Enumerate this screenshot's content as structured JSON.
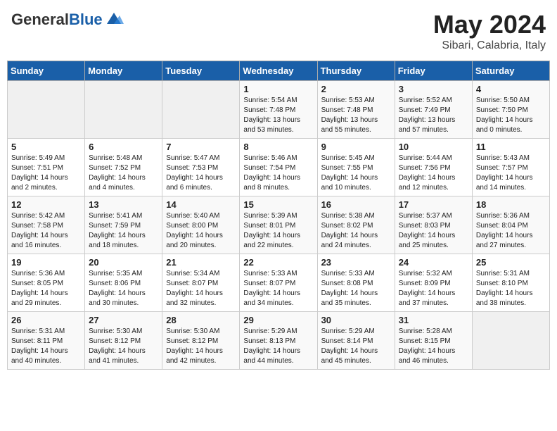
{
  "header": {
    "logo_general": "General",
    "logo_blue": "Blue",
    "month": "May 2024",
    "location": "Sibari, Calabria, Italy"
  },
  "weekdays": [
    "Sunday",
    "Monday",
    "Tuesday",
    "Wednesday",
    "Thursday",
    "Friday",
    "Saturday"
  ],
  "rows": [
    [
      {
        "day": "",
        "sunrise": "",
        "sunset": "",
        "daylight": ""
      },
      {
        "day": "",
        "sunrise": "",
        "sunset": "",
        "daylight": ""
      },
      {
        "day": "",
        "sunrise": "",
        "sunset": "",
        "daylight": ""
      },
      {
        "day": "1",
        "sunrise": "Sunrise: 5:54 AM",
        "sunset": "Sunset: 7:48 PM",
        "daylight": "Daylight: 13 hours and 53 minutes."
      },
      {
        "day": "2",
        "sunrise": "Sunrise: 5:53 AM",
        "sunset": "Sunset: 7:48 PM",
        "daylight": "Daylight: 13 hours and 55 minutes."
      },
      {
        "day": "3",
        "sunrise": "Sunrise: 5:52 AM",
        "sunset": "Sunset: 7:49 PM",
        "daylight": "Daylight: 13 hours and 57 minutes."
      },
      {
        "day": "4",
        "sunrise": "Sunrise: 5:50 AM",
        "sunset": "Sunset: 7:50 PM",
        "daylight": "Daylight: 14 hours and 0 minutes."
      }
    ],
    [
      {
        "day": "5",
        "sunrise": "Sunrise: 5:49 AM",
        "sunset": "Sunset: 7:51 PM",
        "daylight": "Daylight: 14 hours and 2 minutes."
      },
      {
        "day": "6",
        "sunrise": "Sunrise: 5:48 AM",
        "sunset": "Sunset: 7:52 PM",
        "daylight": "Daylight: 14 hours and 4 minutes."
      },
      {
        "day": "7",
        "sunrise": "Sunrise: 5:47 AM",
        "sunset": "Sunset: 7:53 PM",
        "daylight": "Daylight: 14 hours and 6 minutes."
      },
      {
        "day": "8",
        "sunrise": "Sunrise: 5:46 AM",
        "sunset": "Sunset: 7:54 PM",
        "daylight": "Daylight: 14 hours and 8 minutes."
      },
      {
        "day": "9",
        "sunrise": "Sunrise: 5:45 AM",
        "sunset": "Sunset: 7:55 PM",
        "daylight": "Daylight: 14 hours and 10 minutes."
      },
      {
        "day": "10",
        "sunrise": "Sunrise: 5:44 AM",
        "sunset": "Sunset: 7:56 PM",
        "daylight": "Daylight: 14 hours and 12 minutes."
      },
      {
        "day": "11",
        "sunrise": "Sunrise: 5:43 AM",
        "sunset": "Sunset: 7:57 PM",
        "daylight": "Daylight: 14 hours and 14 minutes."
      }
    ],
    [
      {
        "day": "12",
        "sunrise": "Sunrise: 5:42 AM",
        "sunset": "Sunset: 7:58 PM",
        "daylight": "Daylight: 14 hours and 16 minutes."
      },
      {
        "day": "13",
        "sunrise": "Sunrise: 5:41 AM",
        "sunset": "Sunset: 7:59 PM",
        "daylight": "Daylight: 14 hours and 18 minutes."
      },
      {
        "day": "14",
        "sunrise": "Sunrise: 5:40 AM",
        "sunset": "Sunset: 8:00 PM",
        "daylight": "Daylight: 14 hours and 20 minutes."
      },
      {
        "day": "15",
        "sunrise": "Sunrise: 5:39 AM",
        "sunset": "Sunset: 8:01 PM",
        "daylight": "Daylight: 14 hours and 22 minutes."
      },
      {
        "day": "16",
        "sunrise": "Sunrise: 5:38 AM",
        "sunset": "Sunset: 8:02 PM",
        "daylight": "Daylight: 14 hours and 24 minutes."
      },
      {
        "day": "17",
        "sunrise": "Sunrise: 5:37 AM",
        "sunset": "Sunset: 8:03 PM",
        "daylight": "Daylight: 14 hours and 25 minutes."
      },
      {
        "day": "18",
        "sunrise": "Sunrise: 5:36 AM",
        "sunset": "Sunset: 8:04 PM",
        "daylight": "Daylight: 14 hours and 27 minutes."
      }
    ],
    [
      {
        "day": "19",
        "sunrise": "Sunrise: 5:36 AM",
        "sunset": "Sunset: 8:05 PM",
        "daylight": "Daylight: 14 hours and 29 minutes."
      },
      {
        "day": "20",
        "sunrise": "Sunrise: 5:35 AM",
        "sunset": "Sunset: 8:06 PM",
        "daylight": "Daylight: 14 hours and 30 minutes."
      },
      {
        "day": "21",
        "sunrise": "Sunrise: 5:34 AM",
        "sunset": "Sunset: 8:07 PM",
        "daylight": "Daylight: 14 hours and 32 minutes."
      },
      {
        "day": "22",
        "sunrise": "Sunrise: 5:33 AM",
        "sunset": "Sunset: 8:07 PM",
        "daylight": "Daylight: 14 hours and 34 minutes."
      },
      {
        "day": "23",
        "sunrise": "Sunrise: 5:33 AM",
        "sunset": "Sunset: 8:08 PM",
        "daylight": "Daylight: 14 hours and 35 minutes."
      },
      {
        "day": "24",
        "sunrise": "Sunrise: 5:32 AM",
        "sunset": "Sunset: 8:09 PM",
        "daylight": "Daylight: 14 hours and 37 minutes."
      },
      {
        "day": "25",
        "sunrise": "Sunrise: 5:31 AM",
        "sunset": "Sunset: 8:10 PM",
        "daylight": "Daylight: 14 hours and 38 minutes."
      }
    ],
    [
      {
        "day": "26",
        "sunrise": "Sunrise: 5:31 AM",
        "sunset": "Sunset: 8:11 PM",
        "daylight": "Daylight: 14 hours and 40 minutes."
      },
      {
        "day": "27",
        "sunrise": "Sunrise: 5:30 AM",
        "sunset": "Sunset: 8:12 PM",
        "daylight": "Daylight: 14 hours and 41 minutes."
      },
      {
        "day": "28",
        "sunrise": "Sunrise: 5:30 AM",
        "sunset": "Sunset: 8:12 PM",
        "daylight": "Daylight: 14 hours and 42 minutes."
      },
      {
        "day": "29",
        "sunrise": "Sunrise: 5:29 AM",
        "sunset": "Sunset: 8:13 PM",
        "daylight": "Daylight: 14 hours and 44 minutes."
      },
      {
        "day": "30",
        "sunrise": "Sunrise: 5:29 AM",
        "sunset": "Sunset: 8:14 PM",
        "daylight": "Daylight: 14 hours and 45 minutes."
      },
      {
        "day": "31",
        "sunrise": "Sunrise: 5:28 AM",
        "sunset": "Sunset: 8:15 PM",
        "daylight": "Daylight: 14 hours and 46 minutes."
      },
      {
        "day": "",
        "sunrise": "",
        "sunset": "",
        "daylight": ""
      }
    ]
  ]
}
